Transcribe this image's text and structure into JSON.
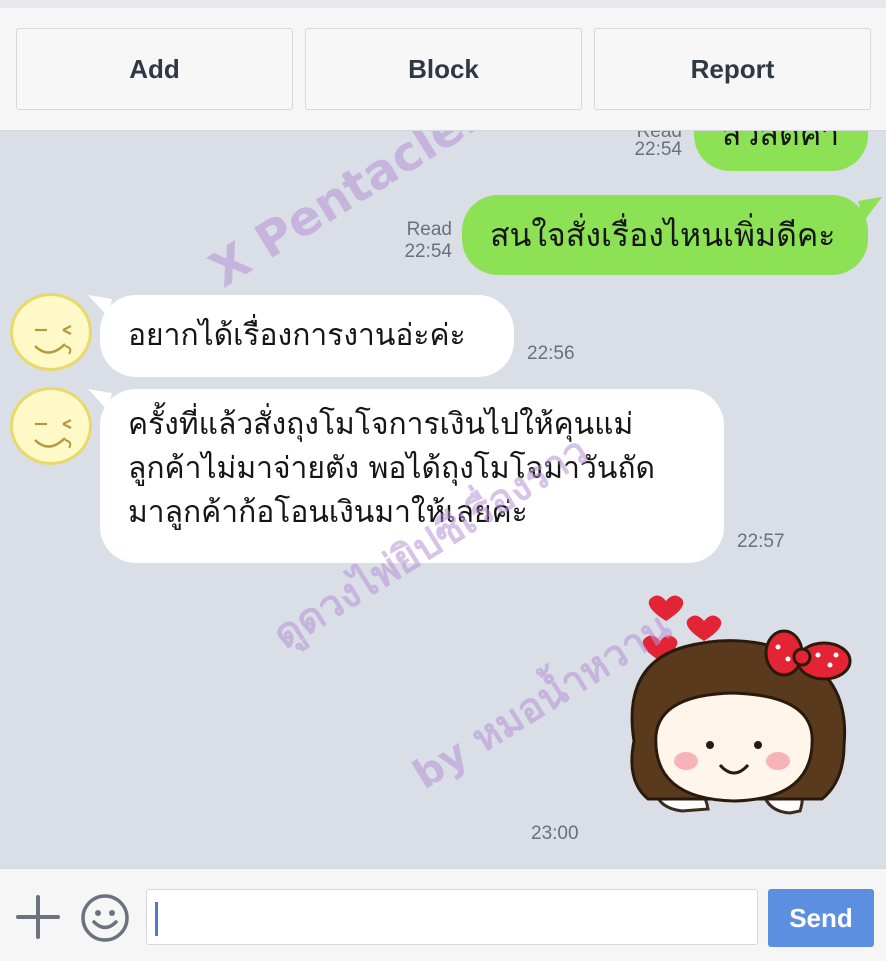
{
  "top_actions": {
    "add": "Add",
    "block": "Block",
    "report": "Report"
  },
  "messages": [
    {
      "side": "sent",
      "text": "สวัสดีค่า",
      "read": "Read",
      "time": "22:54"
    },
    {
      "side": "sent",
      "text": "สนใจสั่งเรื่องไหนเพิ่มดีคะ",
      "read": "Read",
      "time": "22:54"
    },
    {
      "side": "received",
      "text": "อยากได้เรื่องการงานอ่ะค่ะ",
      "time": "22:56"
    },
    {
      "side": "received",
      "lines": [
        "ครั้งที่แล้วสั่งถุงโมโจการเงินไปให้คุนแม่",
        "ลูกค้าไม่มาจ่ายตัง พอได้ถุงโมโจมาวันถัด",
        "มาลูกค้าก้อโอนเงินมาให้เลยค่ะ"
      ],
      "time": "22:57"
    },
    {
      "side": "sent",
      "type": "sticker",
      "sticker_icon": "smiling-girl-sticker",
      "time": "23:00"
    }
  ],
  "watermarks": {
    "line1": "X Pentacles",
    "line2": "ดูดวงไพ่ยิปซีเรื่องราว",
    "line3": "by หมอน้ำหวาน"
  },
  "input": {
    "placeholder": "",
    "send_label": "Send"
  },
  "icons": {
    "add": "plus-icon",
    "emoji": "smiley-icon"
  },
  "colors": {
    "sent_bubble": "#8ce155",
    "received_bubble": "#ffffff",
    "background": "#d9dee7",
    "send_button": "#5d8fe0",
    "watermark": "#b792d6"
  }
}
